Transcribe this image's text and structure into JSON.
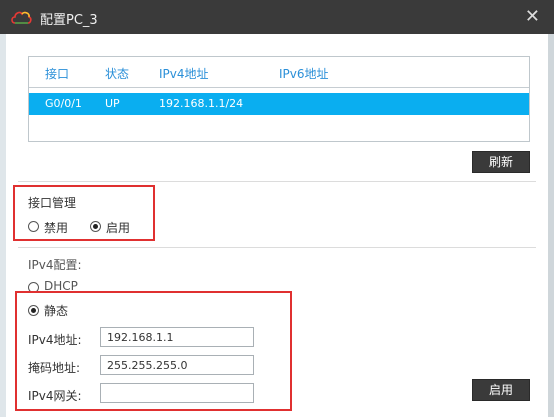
{
  "window": {
    "title": "配置PC_3",
    "close_label": "✕"
  },
  "interfaces": {
    "headers": [
      "接口",
      "状态",
      "IPv4地址",
      "IPv6地址"
    ],
    "rows": [
      {
        "port": "G0/0/1",
        "status": "UP",
        "ipv4": "192.168.1.1/24",
        "ipv6": ""
      }
    ]
  },
  "refresh_label": "刷新",
  "iface_mgmt": {
    "label": "接口管理",
    "disable_label": "禁用",
    "enable_label": "启用",
    "selected": "启用"
  },
  "ipv4_config": {
    "label": "IPv4配置:",
    "dhcp_label": "DHCP",
    "static_label": "静态",
    "selected": "静态",
    "ip_label": "IPv4地址:",
    "ip_value": "192.168.1.1",
    "mask_label": "掩码地址:",
    "mask_value": "255.255.255.0",
    "gateway_label": "IPv4网关:",
    "gateway_value": ""
  },
  "apply_label": "启用"
}
